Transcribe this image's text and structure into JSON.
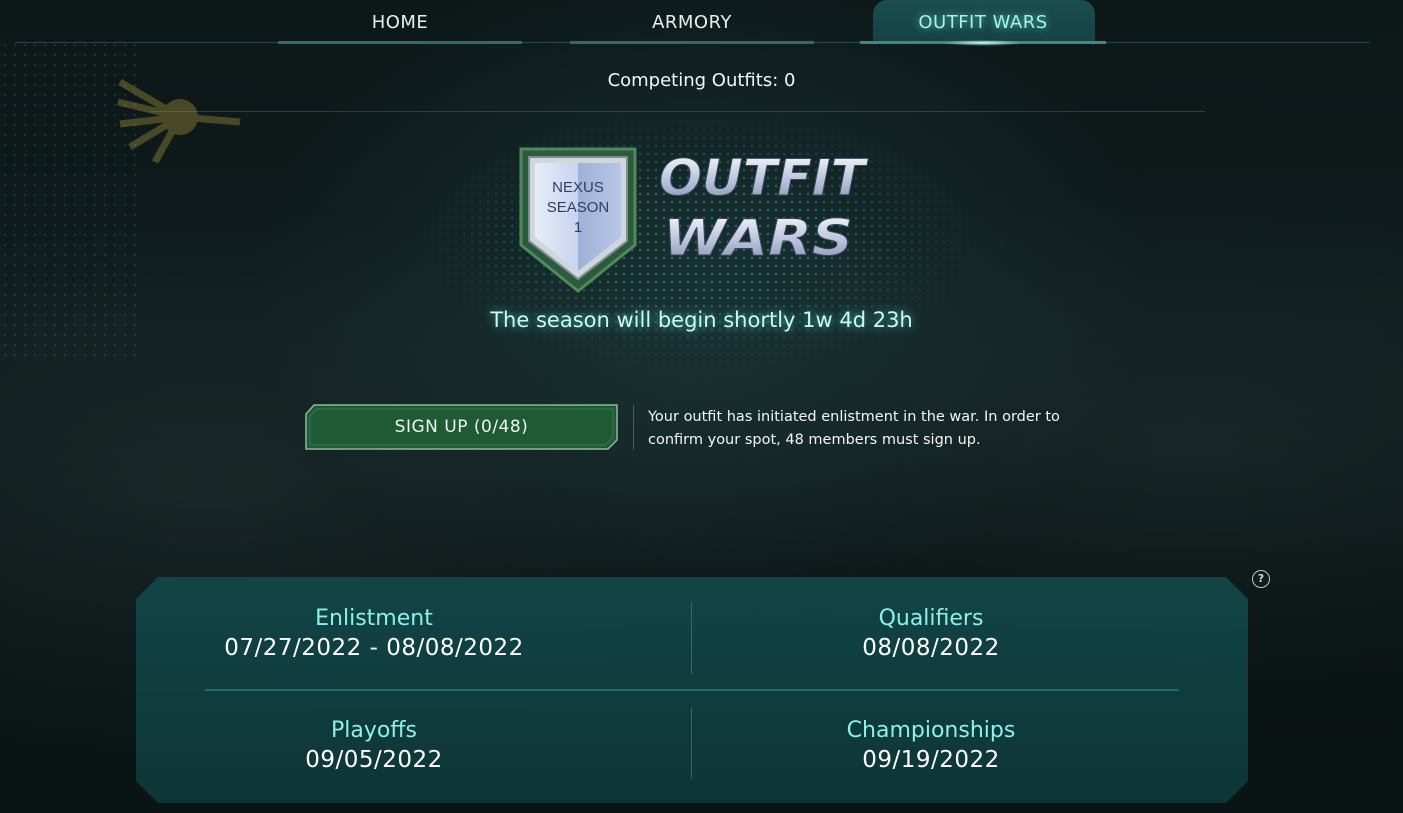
{
  "nav": {
    "tabs": [
      {
        "label": "HOME",
        "active": false
      },
      {
        "label": "ARMORY",
        "active": false
      },
      {
        "label": "OUTFIT WARS",
        "active": true
      }
    ]
  },
  "competing_outfits": "Competing Outfits: 0",
  "logo": {
    "badge_lines": [
      "NEXUS",
      "SEASON",
      "1"
    ],
    "wordmark_lines": [
      "OUTFIT",
      "WARS"
    ]
  },
  "season_status": "The season will begin shortly 1w 4d 23h",
  "signup": {
    "button_label": "SIGN UP (0/48)",
    "info": "Your outfit has initiated enlistment in the war. In order to confirm your spot, 48 members must sign up."
  },
  "help_icon": "question-circle-icon",
  "schedule": [
    {
      "label": "Enlistment",
      "date": "07/27/2022 - 08/08/2022"
    },
    {
      "label": "Qualifiers",
      "date": "08/08/2022"
    },
    {
      "label": "Playoffs",
      "date": "09/05/2022"
    },
    {
      "label": "Championships",
      "date": "09/19/2022"
    }
  ],
  "colors": {
    "accent": "#8df0ea",
    "panel": "#0f3a3c",
    "signup_green": "#1e5a34"
  }
}
